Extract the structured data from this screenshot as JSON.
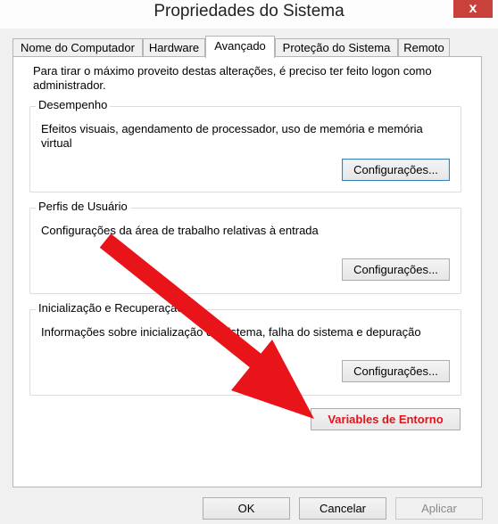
{
  "window": {
    "title": "Propriedades do Sistema",
    "close_label": "x"
  },
  "tabs": [
    {
      "label": "Nome do Computador"
    },
    {
      "label": "Hardware"
    },
    {
      "label": "Avançado"
    },
    {
      "label": "Proteção do Sistema"
    },
    {
      "label": "Remoto"
    }
  ],
  "active_tab": "Avançado",
  "panel": {
    "intro_text": "Para tirar o máximo proveito destas alterações, é preciso ter feito logon como administrador.",
    "performance": {
      "title": "Desempenho",
      "description": "Efeitos visuais, agendamento de processador, uso de memória e memória virtual",
      "button": "Configurações..."
    },
    "user_profiles": {
      "title": "Perfis de Usuário",
      "description": "Configurações da área de trabalho relativas à entrada",
      "button": "Configurações..."
    },
    "startup": {
      "title": "Inicialização e Recuperação",
      "description": "Informações sobre inicialização do sistema, falha do sistema e depuração",
      "button": "Configurações..."
    },
    "env_button": "Variables de Entorno"
  },
  "footer": {
    "ok": "OK",
    "cancel": "Cancelar",
    "apply": "Aplicar"
  },
  "annotation_color": "#e8141a"
}
